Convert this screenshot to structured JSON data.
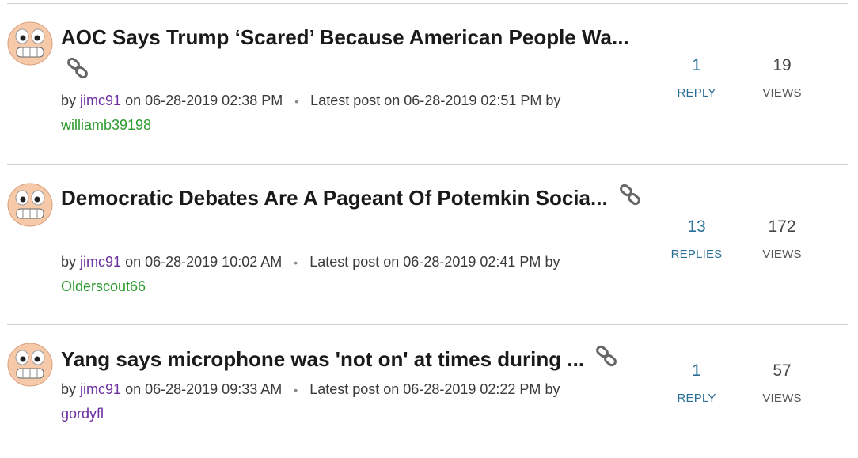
{
  "threads": [
    {
      "title": "AOC Says Trump ‘Scared’ Because American People Wa...",
      "by_label": "by",
      "author": "jimc91",
      "on_label": "on",
      "posted": "06-28-2019 02:38 PM",
      "latest_label": "Latest post on",
      "latest": "06-28-2019 02:51 PM",
      "latest_by_label": "by",
      "latest_user": "williamb39198",
      "replies_count": "1",
      "replies_label": "REPLY",
      "views_count": "19",
      "views_label": "VIEWS"
    },
    {
      "title": "Democratic Debates Are A Pageant Of Potemkin Socia...",
      "by_label": "by",
      "author": "jimc91",
      "on_label": "on",
      "posted": "06-28-2019 10:02 AM",
      "latest_label": "Latest post on",
      "latest": "06-28-2019 02:41 PM",
      "latest_by_label": "by",
      "latest_user": "Olderscout66",
      "replies_count": "13",
      "replies_label": "REPLIES",
      "views_count": "172",
      "views_label": "VIEWS"
    },
    {
      "title": "Yang says microphone was 'not on' at times during ...",
      "by_label": "by",
      "author": "jimc91",
      "on_label": "on",
      "posted": "06-28-2019 09:33 AM",
      "latest_label": "Latest post on",
      "latest": "06-28-2019 02:22 PM",
      "latest_by_label": "by",
      "latest_user": "gordyfl",
      "replies_count": "1",
      "replies_label": "REPLY",
      "views_count": "57",
      "views_label": "VIEWS"
    }
  ],
  "icons": {
    "avatar": "grinning-face-icon",
    "link": "chain-link-icon"
  },
  "colors": {
    "title": "#1a1a1a",
    "author": "#6b2fa0",
    "latest_user_green": "#2e9b2e",
    "latest_user_purple": "#6b2fa0",
    "replies": "#2a6f97",
    "divider": "#cfcfcf"
  }
}
